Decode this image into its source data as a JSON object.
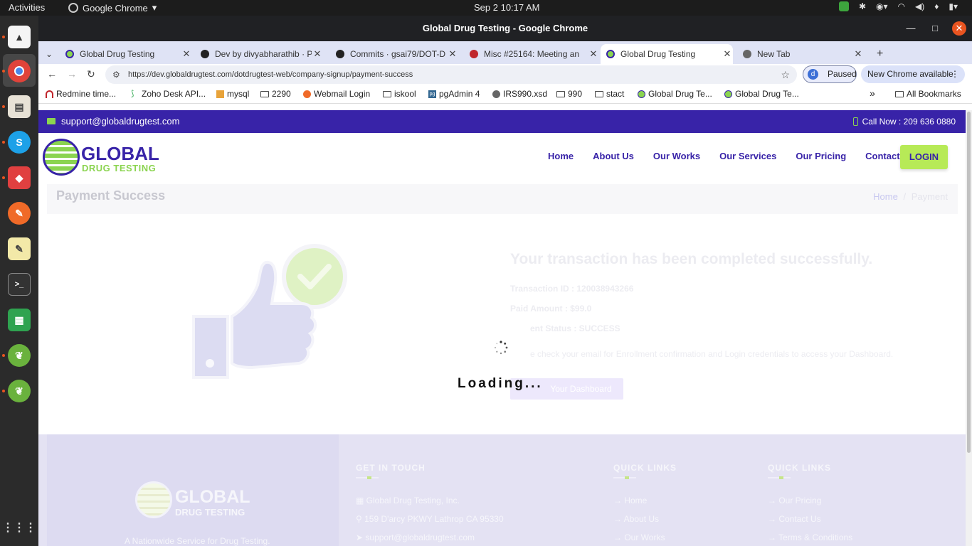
{
  "system": {
    "activities": "Activities",
    "app_name": "Google Chrome",
    "clock": "Sep 2  10:17 AM"
  },
  "window": {
    "title": "Global Drug Testing - Google Chrome"
  },
  "tabs": [
    {
      "label": "Global Drug Testing"
    },
    {
      "label": "Dev by divyabharathib · P"
    },
    {
      "label": "Commits · gsai79/DOT-D"
    },
    {
      "label": "Misc #25164: Meeting an"
    },
    {
      "label": "Global Drug Testing"
    },
    {
      "label": "New Tab"
    }
  ],
  "toolbar": {
    "url": "https://dev.globaldrugtest.com/dotdrugtest-web/company-signup/payment-success",
    "paused_label": "Paused",
    "profile_initial": "d",
    "new_chrome_label": "New Chrome available"
  },
  "bookmarks": [
    {
      "label": "Redmine time..."
    },
    {
      "label": "Zoho Desk API..."
    },
    {
      "label": "mysql"
    },
    {
      "label": "2290"
    },
    {
      "label": "Webmail Login"
    },
    {
      "label": "iskool"
    },
    {
      "label": "pgAdmin 4"
    },
    {
      "label": "IRS990.xsd"
    },
    {
      "label": "990"
    },
    {
      "label": "stact"
    },
    {
      "label": "Global Drug Te..."
    },
    {
      "label": "Global Drug Te..."
    }
  ],
  "bookmarks_more": "»",
  "all_bookmarks": "All Bookmarks",
  "site": {
    "support_email": "support@globaldrugtest.com",
    "call_now": "Call Now : 209 636 0880",
    "logo_line1": "GLOBAL",
    "logo_line2": "DRUG TESTING",
    "nav": {
      "home": "Home",
      "about": "About Us",
      "works": "Our Works",
      "services": "Our Services",
      "pricing": "Our Pricing",
      "contact": "Contact Us"
    },
    "login": "LOGIN",
    "page_title": "Payment Success",
    "breadcrumb_home": "Home",
    "breadcrumb_sep": "/",
    "breadcrumb_current": "Payment",
    "success_heading": "Your transaction has been completed successfully.",
    "transaction_id": "Transaction ID : 120038943266",
    "paid_amount": "Paid Amount : $99.0",
    "payment_status": "ent Status : SUCCESS",
    "note": "e check your email for Enrollment confirmation and Login credentials to access your Dashboard.",
    "dashboard_btn": "Your Dashboard",
    "loading": "Loading...",
    "footer": {
      "tagline": "A Nationwide Service for Drug Testing.",
      "get_in_touch": "GET IN TOUCH",
      "company": "Global Drug Testing, Inc.",
      "address": "159 D'arcy PKWY Lathrop CA 95330",
      "email": "support@globaldrugtest.com",
      "quick_links_1": "QUICK LINKS",
      "ql1": [
        "Home",
        "About Us",
        "Our Works"
      ],
      "quick_links_2": "QUICK LINKS",
      "ql2": [
        "Our Pricing",
        "Contact Us",
        "Terms & Conditions"
      ]
    }
  },
  "colors": {
    "brand_purple": "#3823a8",
    "brand_green": "#8bd450",
    "login_green": "#b7ea57"
  }
}
